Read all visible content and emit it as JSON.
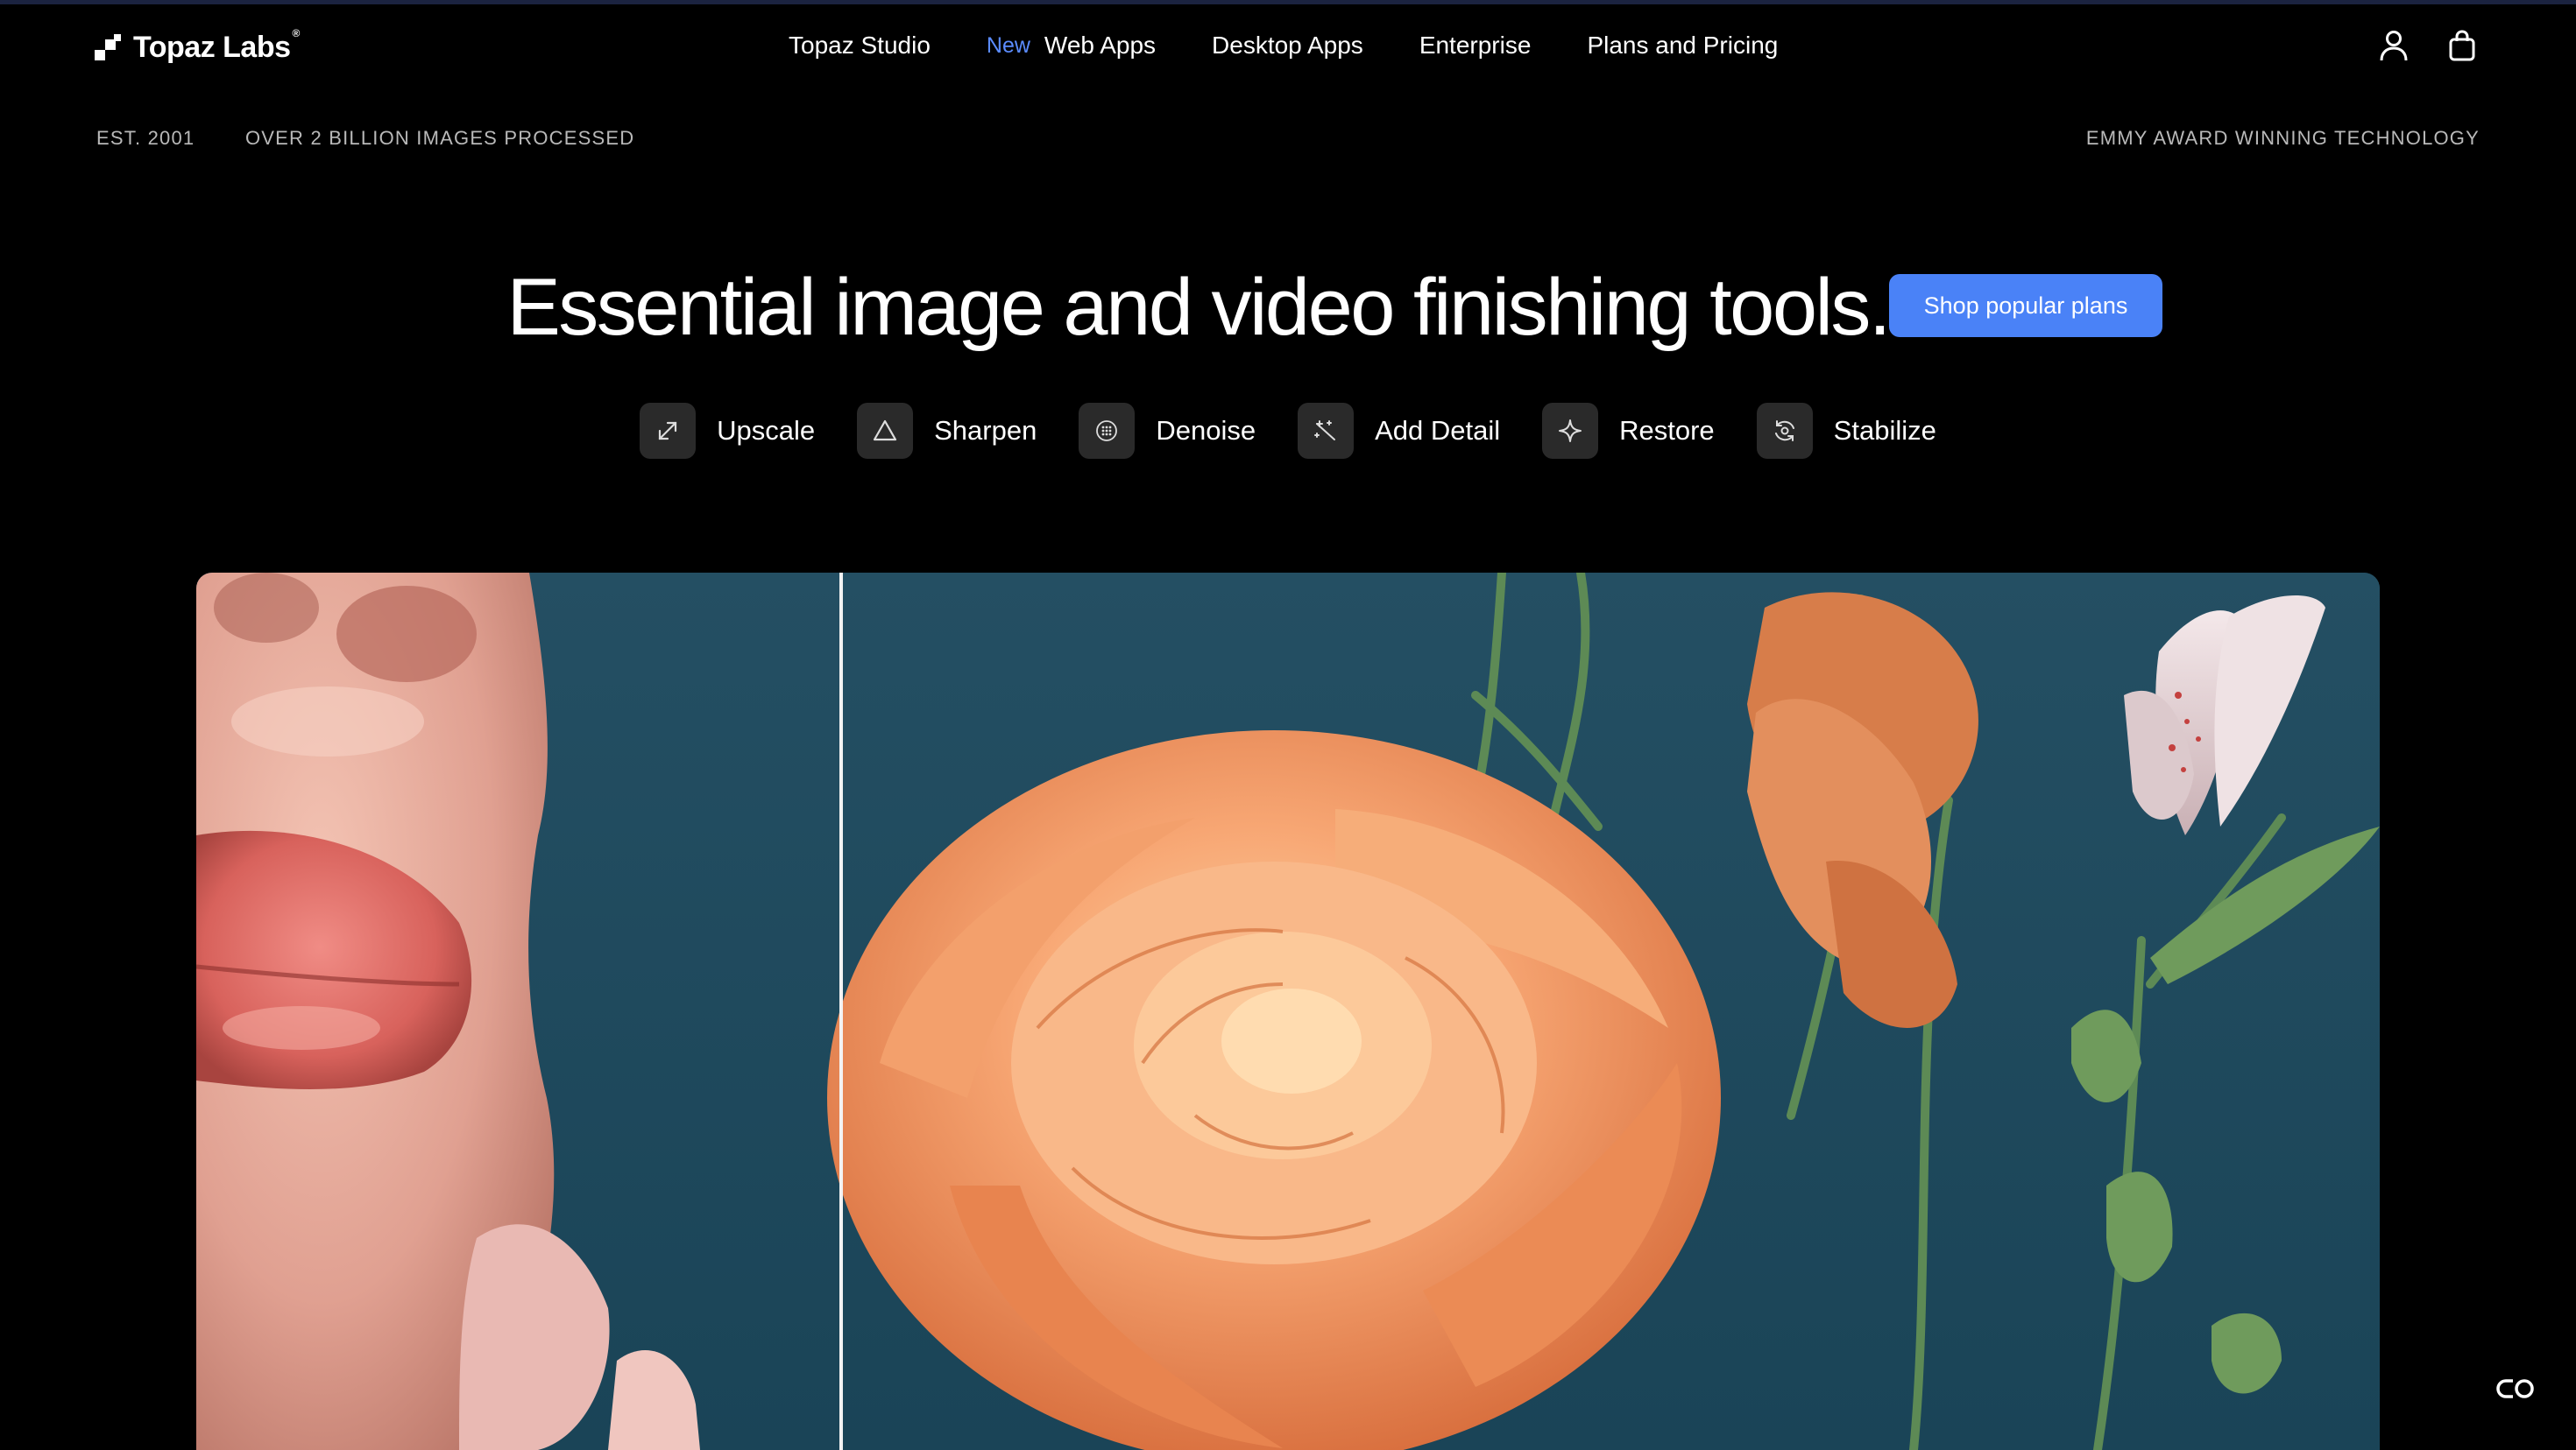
{
  "header": {
    "logo_text": "Topaz Labs",
    "logo_mark": "registered",
    "nav": [
      {
        "label": "Topaz Studio"
      },
      {
        "label": "Web Apps",
        "tag": "New"
      },
      {
        "label": "Desktop Apps"
      },
      {
        "label": "Enterprise"
      },
      {
        "label": "Plans and Pricing"
      }
    ],
    "icons": [
      "account-icon",
      "cart-icon"
    ]
  },
  "strip": {
    "est": "EST. 2001",
    "processed": "OVER 2 BILLION IMAGES PROCESSED",
    "award": "EMMY AWARD WINNING TECHNOLOGY"
  },
  "hero": {
    "title": "Essential image and video finishing tools.",
    "cta": "Shop popular plans",
    "tools": [
      {
        "label": "Upscale",
        "icon": "upscale-icon"
      },
      {
        "label": "Sharpen",
        "icon": "sharpen-icon"
      },
      {
        "label": "Denoise",
        "icon": "denoise-icon"
      },
      {
        "label": "Add Detail",
        "icon": "add-detail-icon"
      },
      {
        "label": "Restore",
        "icon": "restore-icon"
      },
      {
        "label": "Stabilize",
        "icon": "stabilize-icon"
      }
    ]
  },
  "colors": {
    "accent": "#4a82f7",
    "new_tag": "#5b8cff",
    "background": "#000000",
    "muted_text": "#b9b9b9"
  },
  "compare": {
    "subjects": [
      "face-closeup",
      "orange-rose",
      "lilies"
    ]
  },
  "widgets": {
    "chat_icon": "chat-icon"
  }
}
